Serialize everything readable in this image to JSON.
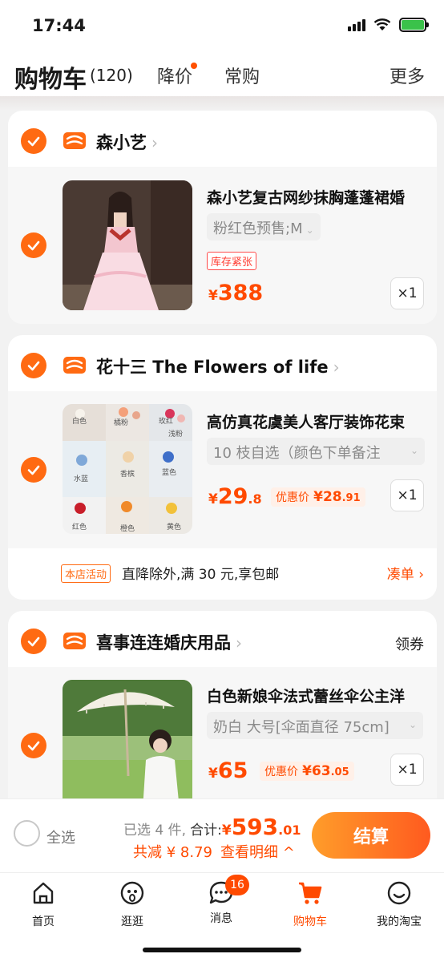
{
  "status_bar": {
    "time": "17:44"
  },
  "header": {
    "title": "购物车",
    "count": "(120)",
    "tab_discount": "降价",
    "tab_frequent": "常购",
    "more": "更多"
  },
  "stores": [
    {
      "name": "森小艺",
      "item": {
        "title": "森小艺复古网纱抹胸蓬蓬裙婚",
        "sku": "粉红色预售;M",
        "tag": "库存紧张",
        "price_symbol": "¥",
        "price_main": "388",
        "quantity": "×1"
      }
    },
    {
      "name": "花十三 The Flowers of life",
      "item": {
        "title": "高仿真花虞美人客厅装饰花束",
        "sku": "10 枝自选（颜色下单备注",
        "price_symbol": "¥",
        "price_main": "29",
        "price_dec": ".8",
        "promo_label": "优惠价",
        "promo_symbol": "¥",
        "promo_main": "28",
        "promo_dec": ".91",
        "quantity": "×1",
        "image_labels": [
          "白色",
          "橘粉",
          "玫红",
          "浅粉",
          "水蓝",
          "香槟",
          "蓝色",
          "红色",
          "橙色",
          "黄色"
        ]
      },
      "activity": {
        "badge": "本店活动",
        "text": "直降除外,满 30 元,享包邮",
        "link": "凑单"
      }
    },
    {
      "name": "喜事连连婚庆用品",
      "coupon": "领券",
      "item": {
        "title": "白色新娘伞法式蕾丝伞公主洋",
        "sku": "奶白 大号[伞面直径 75cm]",
        "price_symbol": "¥",
        "price_main": "65",
        "promo_label": "优惠价",
        "promo_symbol": "¥",
        "promo_main": "63",
        "promo_dec": ".05",
        "quantity": "×1"
      }
    }
  ],
  "checkout": {
    "select_all": "全选",
    "selected": "已选 4 件,",
    "total_label": "合计:",
    "total_symbol": "¥",
    "total_main": "593",
    "total_dec": ".01",
    "savings": "共减 ¥ 8.79",
    "detail": "查看明细",
    "pay_button": "结算"
  },
  "tabbar": {
    "home": "首页",
    "browse": "逛逛",
    "messages": "消息",
    "messages_badge": "16",
    "cart": "购物车",
    "profile": "我的淘宝"
  },
  "colors": {
    "accent": "#ff4a00",
    "check": "#ff6a12"
  }
}
